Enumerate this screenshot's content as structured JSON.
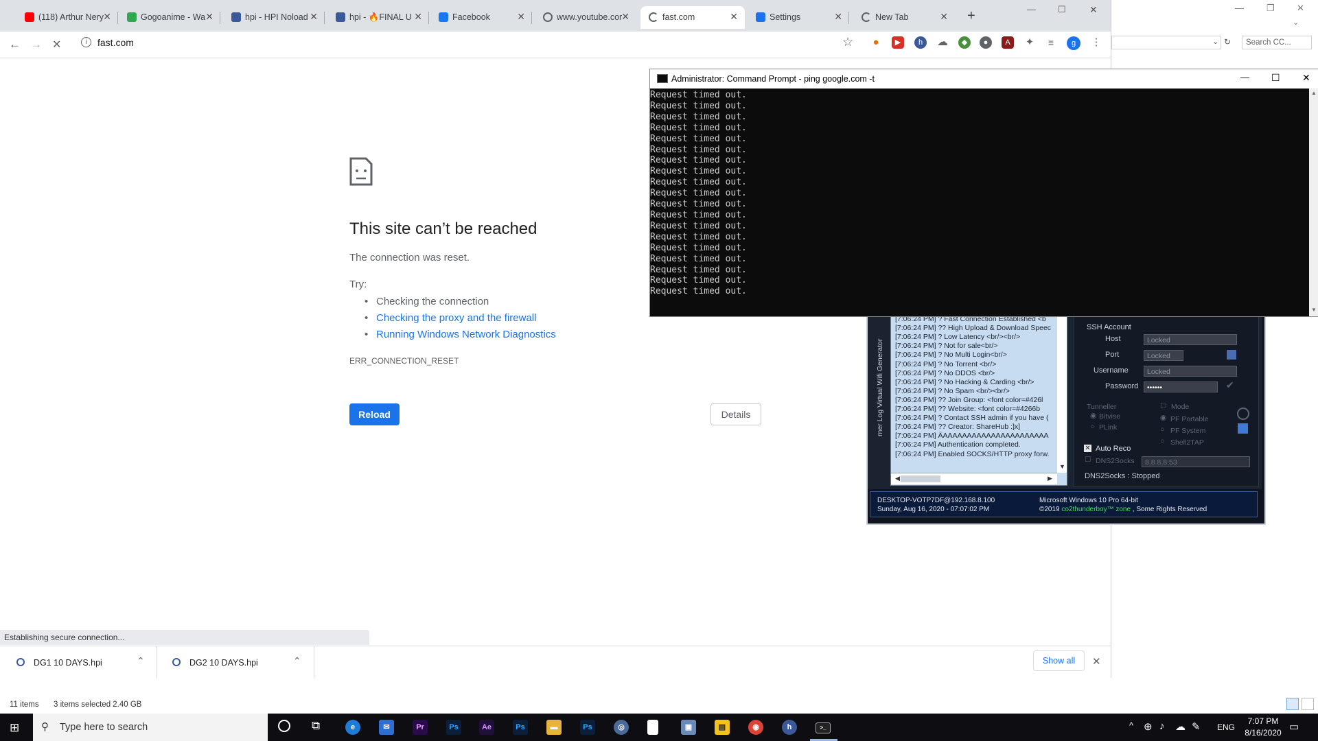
{
  "explorer": {
    "search_placeholder": "Search CC...",
    "status_items": "11 items",
    "status_selected": "3 items selected  2.40 GB"
  },
  "chrome": {
    "tabs": [
      {
        "title": "(118) Arthur Nery",
        "icon": "youtube-icon",
        "color": "#ff0000"
      },
      {
        "title": "Gogoanime - Wa",
        "icon": "shield-icon",
        "color": "#2fa84f"
      },
      {
        "title": "hpi - HPI Noload",
        "icon": "vpn-icon",
        "color": "#3b5998"
      },
      {
        "title": "hpi - 🔥FINAL U",
        "icon": "vpn-icon",
        "color": "#3b5998"
      },
      {
        "title": "Facebook",
        "icon": "facebook-icon",
        "color": "#1877f2"
      },
      {
        "title": "www.youtube.com",
        "icon": "globe-icon",
        "color": "#5f6368"
      },
      {
        "title": "fast.com",
        "icon": "loading-icon",
        "color": "#5f6368"
      },
      {
        "title": "Settings",
        "icon": "gear-icon",
        "color": "#1a73e8"
      },
      {
        "title": "New Tab",
        "icon": "loading-icon",
        "color": "#5f6368"
      }
    ],
    "url": "fast.com",
    "profile_initial": "g",
    "error": {
      "title": "This site can’t be reached",
      "subtitle": "The connection was reset.",
      "try_label": "Try:",
      "suggestions": [
        "Checking the connection",
        "Checking the proxy and the firewall",
        "Running Windows Network Diagnostics"
      ],
      "code": "ERR_CONNECTION_RESET",
      "reload_label": "Reload",
      "details_label": "Details"
    },
    "status_bar": "Establishing secure connection...",
    "downloads": [
      {
        "name": "DG1 10 DAYS.hpi"
      },
      {
        "name": "DG2 10 DAYS.hpi"
      }
    ],
    "show_all": "Show all"
  },
  "cmd": {
    "title": "Administrator: Command Prompt - ping  google.com -t",
    "lines": [
      "Request timed out.",
      "Request timed out.",
      "Request timed out.",
      "Request timed out.",
      "Request timed out.",
      "Request timed out.",
      "Request timed out.",
      "Request timed out.",
      "Request timed out.",
      "Request timed out.",
      "Request timed out.",
      "Request timed out.",
      "Request timed out.",
      "Request timed out.",
      "Request timed out.",
      "Request timed out.",
      "Request timed out.",
      "Request timed out.",
      "Request timed out."
    ]
  },
  "vpn": {
    "side_tabs": "rner  Log  Virtual Wifi  Generator",
    "log": [
      "[7:06:24 PM] ? Fast Connection Established <b",
      "[7:06:24 PM] ?? High Upload & Download Speec",
      "[7:06:24 PM] ? Low Latency <br/><br/>",
      "[7:06:24 PM] ? Not for sale<br/>",
      "[7:06:24 PM] ? No Multi Login<br/>",
      "[7:06:24 PM] ? No Torrent <br/>",
      "[7:06:24 PM] ? No DDOS <br/>",
      "[7:06:24 PM] ? No Hacking & Carding <br/>",
      "[7:06:24 PM] ? No Spam <br/><br/>",
      "[7:06:24 PM] ?? Join Group: <font color=#426l",
      "[7:06:24 PM] ?? Website: <font color=#4266b",
      "[7:06:24 PM] ? Contact SSH admin if you have (",
      "[7:06:24 PM] ?? Creator: ShareHub :]x]",
      "[7:06:24 PM] ÄAAAAAAAAAAAAAAAAAAAAAA",
      "[7:06:24 PM] Authentication completed.",
      "[7:06:24 PM] Enabled SOCKS/HTTP proxy forw."
    ],
    "ssh_account": "SSH Account",
    "host_label": "Host",
    "host_value": "Locked",
    "port_label": "Port",
    "port_value": "Locked",
    "username_label": "Username",
    "username_value": "Locked",
    "password_label": "Password",
    "password_value": "••••••",
    "tunneller": "Tunneller",
    "mode": "Mode",
    "bitvise": "Bitvise",
    "plink": "PLink",
    "pf_portable": "PF Portable",
    "pf_system": "PF System",
    "shell2tap": "Shell2TAP",
    "auto_reco": "Auto Reco",
    "dns2socks": "DNS2Socks",
    "dns_value": "8.8.8.8:53",
    "dns_status": "DNS2Socks : Stopped",
    "footer_host": "DESKTOP-VOTP7DF@192.168.8.100",
    "footer_date": "Sunday, Aug 16, 2020 - 07:07:02 PM",
    "footer_os": "Microsoft Windows 10 Pro 64-bit",
    "footer_copyright_pre": "©2019 ",
    "footer_copyright_brand": "co2thunderboy™ zone",
    "footer_copyright_post": " , Some Rights Reserved"
  },
  "taskbar": {
    "search_placeholder": "Type here to search",
    "apps": [
      "Pr",
      "Ps",
      "Ae",
      "Ps",
      "Ps"
    ],
    "lang": "ENG",
    "time": "7:07 PM",
    "date": "8/16/2020"
  }
}
